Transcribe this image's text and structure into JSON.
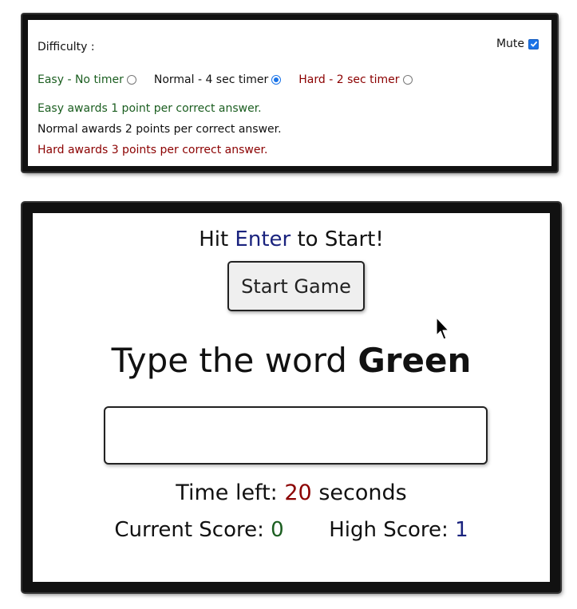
{
  "settings": {
    "difficulty_label": "Difficulty :",
    "mute_label": "Mute",
    "mute_checked": true,
    "options": [
      {
        "label": "Easy - No timer",
        "checked": false,
        "color": "#1b5e20"
      },
      {
        "label": "Normal - 4 sec timer",
        "checked": true,
        "color": "#111111"
      },
      {
        "label": "Hard - 2 sec timer",
        "checked": false,
        "color": "#8b0000"
      }
    ],
    "descriptions": [
      "Easy awards 1 point per correct answer.",
      "Normal awards 2 points per correct answer.",
      "Hard awards 3 points per correct answer."
    ]
  },
  "game": {
    "hint_prefix": "Hit",
    "hint_key": "Enter",
    "hint_suffix": "to Start!",
    "start_button": "Start Game",
    "prompt_prefix": "Type the word",
    "prompt_word": "Green",
    "input_value": "",
    "time_prefix": "Time left:",
    "time_value": "20",
    "time_suffix": "seconds",
    "current_score_label": "Current Score:",
    "current_score_value": "0",
    "high_score_label": "High Score:",
    "high_score_value": "1"
  },
  "icons": {
    "mouse_cursor": "arrow-cursor-icon",
    "mute_check": "check-icon"
  },
  "colors": {
    "easy": "#1b5e20",
    "hard": "#8b0000",
    "accent_blue": "#1a237e",
    "checkbox_blue": "#1a73e8"
  }
}
